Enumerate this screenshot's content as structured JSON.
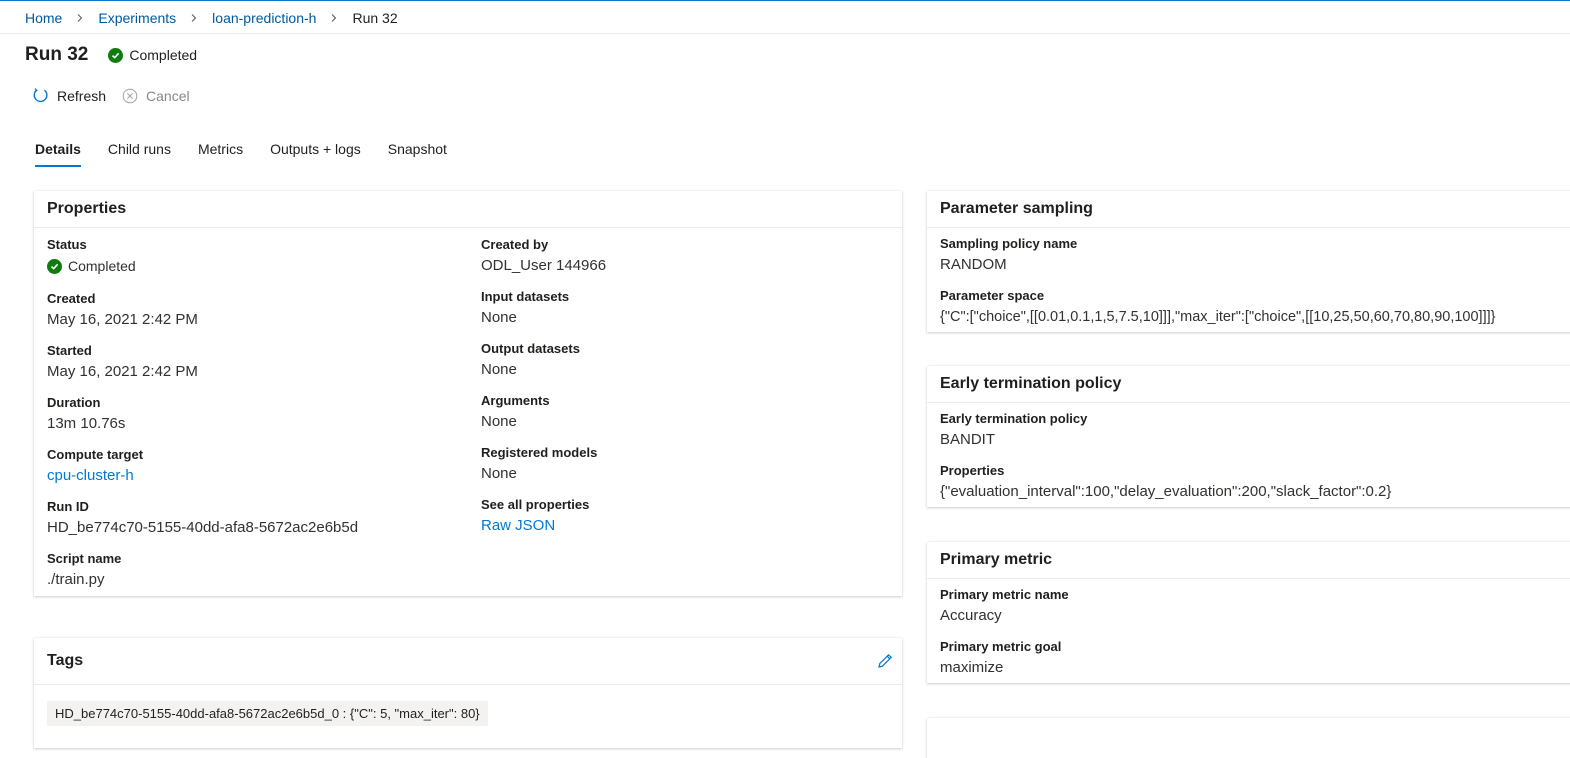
{
  "breadcrumb": {
    "items": [
      "Home",
      "Experiments",
      "loan-prediction-h"
    ],
    "current": "Run 32"
  },
  "header": {
    "title": "Run 32",
    "status": "Completed",
    "status_color": "#107c10"
  },
  "toolbar": {
    "refresh_label": "Refresh",
    "cancel_label": "Cancel"
  },
  "tabs": [
    {
      "label": "Details",
      "active": true
    },
    {
      "label": "Child runs",
      "active": false
    },
    {
      "label": "Metrics",
      "active": false
    },
    {
      "label": "Outputs + logs",
      "active": false
    },
    {
      "label": "Snapshot",
      "active": false
    }
  ],
  "properties": {
    "title": "Properties",
    "status_label": "Status",
    "status_value": "Completed",
    "created_label": "Created",
    "created_value": "May 16, 2021 2:42 PM",
    "started_label": "Started",
    "started_value": "May 16, 2021 2:42 PM",
    "duration_label": "Duration",
    "duration_value": "13m 10.76s",
    "compute_label": "Compute target",
    "compute_value": "cpu-cluster-h",
    "runid_label": "Run ID",
    "runid_value": "HD_be774c70-5155-40dd-afa8-5672ac2e6b5d",
    "script_label": "Script name",
    "script_value": "./train.py",
    "createdby_label": "Created by",
    "createdby_value": "ODL_User 144966",
    "input_label": "Input datasets",
    "input_value": "None",
    "output_label": "Output datasets",
    "output_value": "None",
    "arguments_label": "Arguments",
    "arguments_value": "None",
    "models_label": "Registered models",
    "models_value": "None",
    "allprops_label": "See all properties",
    "allprops_value": "Raw JSON"
  },
  "tags": {
    "title": "Tags",
    "chip": "HD_be774c70-5155-40dd-afa8-5672ac2e6b5d_0 : {\"C\": 5, \"max_iter\": 80}"
  },
  "sampling": {
    "title": "Parameter sampling",
    "policy_label": "Sampling policy name",
    "policy_value": "RANDOM",
    "space_label": "Parameter space",
    "space_value": "{\"C\":[\"choice\",[[0.01,0.1,1,5,7.5,10]]],\"max_iter\":[\"choice\",[[10,25,50,60,70,80,90,100]]]}"
  },
  "early_termination": {
    "title": "Early termination policy",
    "policy_label": "Early termination policy",
    "policy_value": "BANDIT",
    "props_label": "Properties",
    "props_value": "{\"evaluation_interval\":100,\"delay_evaluation\":200,\"slack_factor\":0.2}"
  },
  "primary_metric": {
    "title": "Primary metric",
    "name_label": "Primary metric name",
    "name_value": "Accuracy",
    "goal_label": "Primary metric goal",
    "goal_value": "maximize"
  },
  "colors": {
    "accent": "#0078d4",
    "link": "#005a9e",
    "success": "#107c10"
  }
}
